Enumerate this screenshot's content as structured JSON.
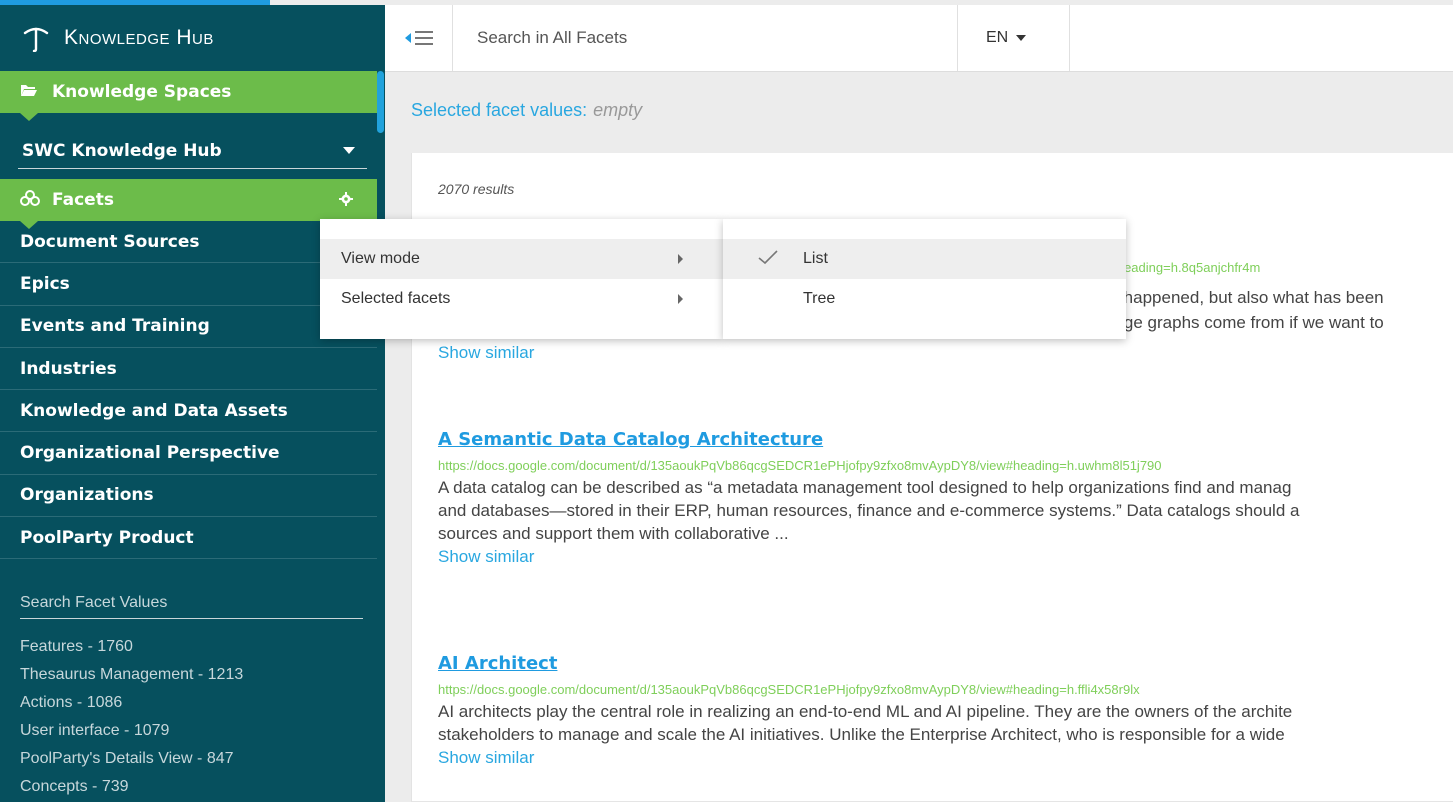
{
  "brand": {
    "title": "Knowledge Hub"
  },
  "sidebar": {
    "spaces_label": "Knowledge Spaces",
    "selected_space": "SWC Knowledge Hub",
    "facets_label": "Facets",
    "facets": [
      "Document Sources",
      "Epics",
      "Events and Training",
      "Industries",
      "Knowledge and Data Assets",
      "Organizational Perspective",
      "Organizations",
      "PoolParty Product"
    ],
    "facet_search_placeholder": "Search Facet Values",
    "facet_values": [
      "Features - 1760",
      "Thesaurus Management - 1213",
      "Actions - 1086",
      "User interface - 1079",
      "PoolParty's Details View - 847",
      "Concepts - 739"
    ]
  },
  "header": {
    "search_placeholder": "Search in All Facets",
    "language": "EN"
  },
  "main": {
    "selected_label": "Selected facet values:",
    "selected_value": "empty",
    "count": "2070 results",
    "partial_result": {
      "url_fragment": "ew#heading=h.8q5anjchfr4m",
      "desc_line1": "as happened, but also what has been",
      "desc_line2": "edge graphs come from if we want to",
      "similar": "Show similar"
    },
    "results": [
      {
        "title": "A Semantic Data Catalog Architecture",
        "url": "https://docs.google.com/document/d/135aoukPqVb86qcgSEDCR1ePHjofpy9zfxo8mvAypDY8/view#heading=h.uwhm8l51j790",
        "desc_line1": "A data catalog can be described as “a metadata management tool designed to help organizations find and manag",
        "desc_line2": "and databases—stored in their ERP, human resources, finance and e-commerce systems.” Data catalogs should a",
        "desc_line3": "sources and support them with collaborative ...",
        "similar": "Show similar"
      },
      {
        "title": "AI Architect",
        "url": "https://docs.google.com/document/d/135aoukPqVb86qcgSEDCR1ePHjofpy9zfxo8mvAypDY8/view#heading=h.ffli4x58r9lx",
        "desc_line1": "AI architects play the central role in realizing an end-to-end ML and AI pipeline. They are the owners of the archite",
        "desc_line2": "stakeholders to manage and scale the AI initiatives. Unlike the Enterprise Architect, who is responsible for a wide",
        "similar": "Show similar"
      }
    ]
  },
  "context_menu": {
    "items": [
      "View mode",
      "Selected facets"
    ],
    "submenu": [
      "List",
      "Tree"
    ],
    "checked": "List"
  },
  "colors": {
    "sidebar_bg": "#06505e",
    "green": "#6cbc4a",
    "accent_blue": "#1f9be0",
    "url_green": "#7fcf5a"
  }
}
